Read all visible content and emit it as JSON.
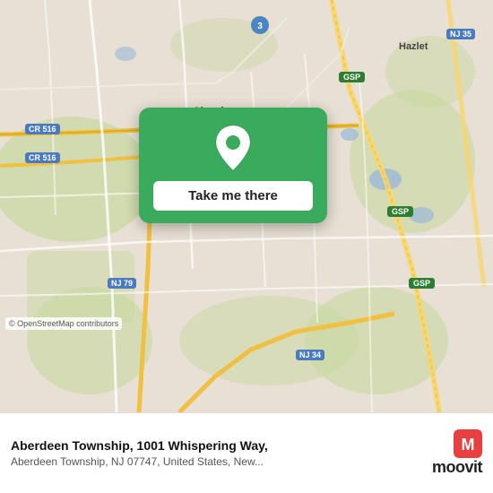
{
  "map": {
    "location_name": "Aberdeen",
    "hazlet_label": "Hazlet",
    "aberdeen_label": "Aberdeen",
    "attribution": "© OpenStreetMap contributors"
  },
  "card": {
    "button_label": "Take me there"
  },
  "bottom_bar": {
    "address_title": "Aberdeen Township, 1001 Whispering Way,",
    "address_detail": "Aberdeen Township, NJ 07747, United States, New...",
    "moovit_label": "moovit"
  },
  "road_labels": {
    "cr516_1": "CR 516",
    "cr516_2": "CR 516",
    "nj79": "NJ 79",
    "nj35": "NJ 35",
    "nj34": "NJ 34",
    "gsp1": "GSP",
    "gsp2": "GSP",
    "gsp3": "GSP",
    "num3": "3"
  }
}
